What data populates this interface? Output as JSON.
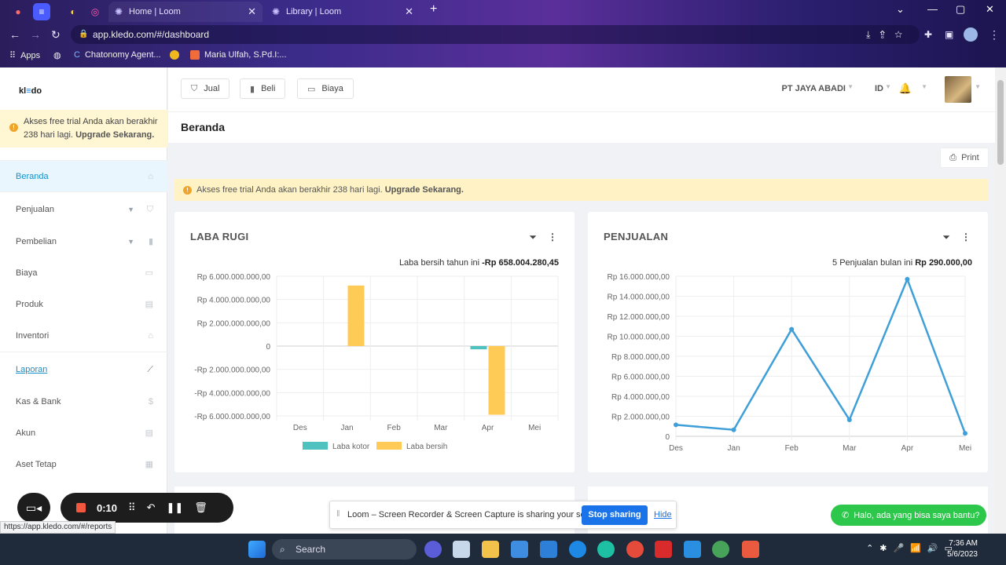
{
  "browser": {
    "tabs": [
      {
        "title": "Home | Loom"
      },
      {
        "title": "Library | Loom"
      }
    ],
    "url": "app.kledo.com/#/dashboard",
    "bookmarks": [
      {
        "label": "Apps"
      },
      {
        "label": "Chatonomy Agent..."
      },
      {
        "label": "Maria Ulfah, S.Pd.I:..."
      }
    ]
  },
  "sidebar": {
    "logo": "kledo",
    "trial_text": "Akses free trial Anda akan berakhir 238 hari lagi.",
    "trial_link": "Upgrade Sekarang.",
    "items": [
      {
        "label": "Beranda"
      },
      {
        "label": "Penjualan"
      },
      {
        "label": "Pembelian"
      },
      {
        "label": "Biaya"
      },
      {
        "label": "Produk"
      },
      {
        "label": "Inventori"
      },
      {
        "label": "Laporan"
      },
      {
        "label": "Kas & Bank"
      },
      {
        "label": "Akun"
      },
      {
        "label": "Aset Tetap"
      }
    ]
  },
  "topbar": {
    "quick": [
      {
        "label": "Jual"
      },
      {
        "label": "Beli"
      },
      {
        "label": "Biaya"
      }
    ],
    "company": "PT JAYA ABADI",
    "lang": "ID"
  },
  "page": {
    "title": "Beranda",
    "print": "Print",
    "trial_text": "Akses free trial Anda akan berakhir 238 hari lagi.",
    "trial_link": "Upgrade Sekarang."
  },
  "laba_rugi": {
    "title": "LABA RUGI",
    "summary_label": "Laba bersih tahun ini",
    "summary_value": "-Rp 658.004.280,45",
    "legend": [
      "Laba kotor",
      "Laba bersih"
    ],
    "colors": {
      "kotor": "#4fc1bf",
      "bersih": "#ffcb57"
    }
  },
  "penjualan": {
    "title": "PENJUALAN",
    "summary_label": "5 Penjualan bulan ini",
    "summary_value": "Rp 290.000,00",
    "color": "#3f9fd8"
  },
  "chart_data": [
    {
      "type": "bar",
      "title": "LABA RUGI",
      "categories": [
        "Des",
        "Jan",
        "Feb",
        "Mar",
        "Apr",
        "Mei"
      ],
      "y_ticks": [
        "Rp 6.000.000.000,00",
        "Rp 4.000.000.000,00",
        "Rp 2.000.000.000,00",
        "0",
        "-Rp 2.000.000.000,00",
        "-Rp 4.000.000.000,00",
        "-Rp 6.000.000.000,00"
      ],
      "ylim": [
        -6000000000,
        6000000000
      ],
      "series": [
        {
          "name": "Laba kotor",
          "values": [
            0,
            0,
            0,
            0,
            -280000000,
            0
          ]
        },
        {
          "name": "Laba bersih",
          "values": [
            0,
            5200000000,
            0,
            0,
            -5900000000,
            0
          ]
        }
      ],
      "grid": true,
      "legend": "bottom"
    },
    {
      "type": "line",
      "title": "PENJUALAN",
      "categories": [
        "Des",
        "Jan",
        "Feb",
        "Mar",
        "Apr",
        "Mei"
      ],
      "y_ticks": [
        "Rp 16.000.000,00",
        "Rp 14.000.000,00",
        "Rp 12.000.000,00",
        "Rp 10.000.000,00",
        "Rp 8.000.000,00",
        "Rp 6.000.000,00",
        "Rp 4.000.000,00",
        "Rp 2.000.000,00",
        "0"
      ],
      "ylim": [
        0,
        16000000
      ],
      "series": [
        {
          "values": [
            1150000,
            650000,
            10700000,
            1650000,
            15700000,
            290000
          ]
        }
      ],
      "grid": true
    }
  ],
  "loom": {
    "timer": "0:10",
    "share_msg": "Loom – Screen Recorder & Screen Capture is sharing your screen.",
    "stop": "Stop sharing",
    "hide": "Hide"
  },
  "chat": {
    "label": "Halo, ada yang bisa saya bantu?"
  },
  "status_url": "https://app.kledo.com/#/reports",
  "taskbar": {
    "search": "Search",
    "time": "7:36 AM",
    "date": "5/6/2023"
  }
}
